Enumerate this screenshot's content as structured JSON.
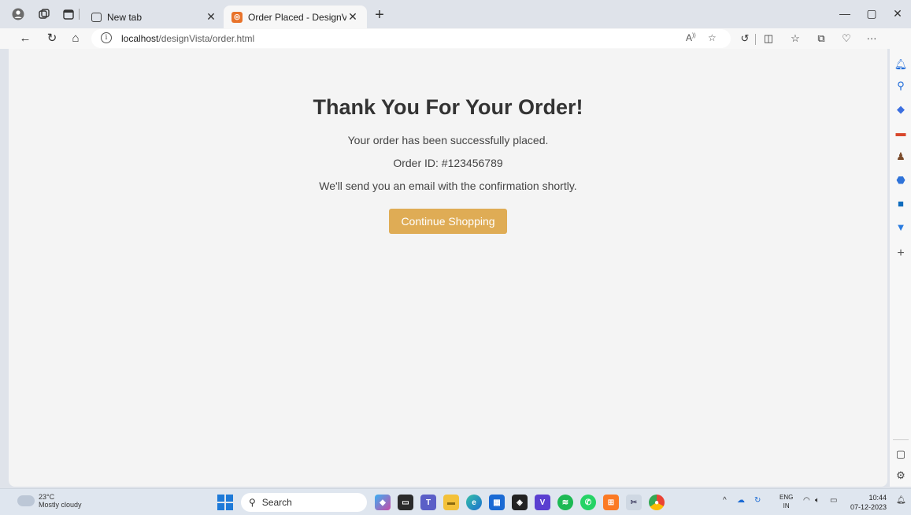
{
  "browser": {
    "tabs": [
      {
        "label": "New tab",
        "icon": "newtab-icon",
        "active": false
      },
      {
        "label": "Order Placed - DesignVista",
        "icon": "site-favicon",
        "active": true
      }
    ],
    "url_host": "localhost",
    "url_path": "/designVista/order.html"
  },
  "page": {
    "heading": "Thank You For Your Order!",
    "message": "Your order has been successfully placed.",
    "order_id": "Order ID: #123456789",
    "email_note": "We'll send you an email with the confirmation shortly.",
    "button_label": "Continue Shopping",
    "button_color": "#dfac55"
  },
  "taskbar": {
    "temperature": "23°C",
    "weather": "Mostly cloudy",
    "search_label": "Search",
    "language": "ENG",
    "region": "IN",
    "time": "10:44",
    "date": "07-12-2023"
  }
}
